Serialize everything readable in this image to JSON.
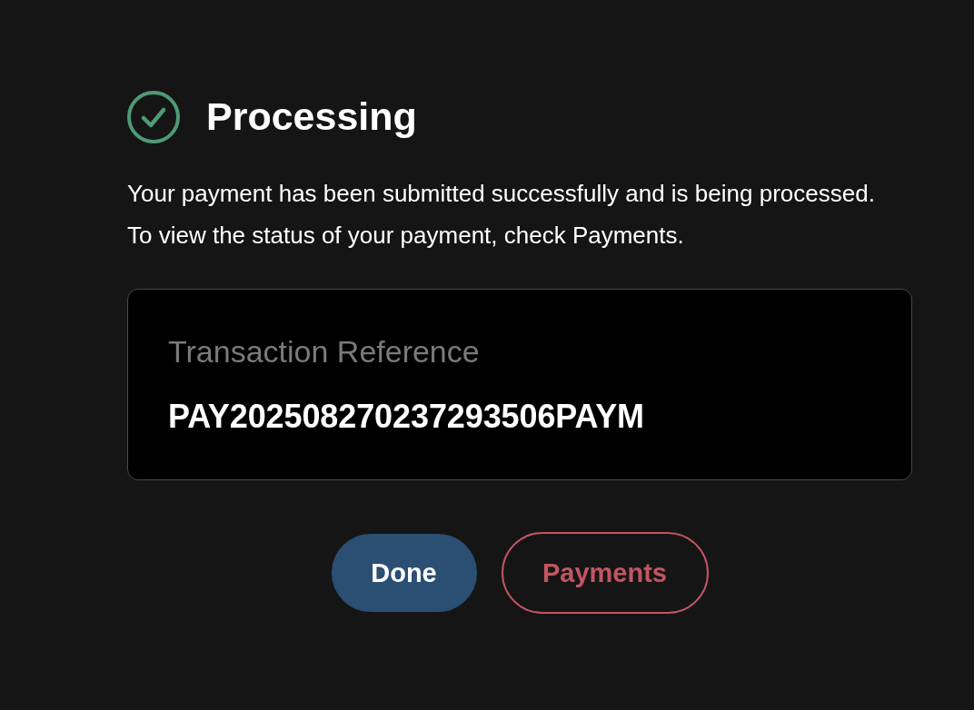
{
  "header": {
    "success": true,
    "title": "Processing"
  },
  "messages": [
    "Your payment has been submitted successfully and is being processed.",
    "To view the status of your payment, check Payments."
  ],
  "reference": {
    "label": "Transaction Reference",
    "value": "PAY202508270237293506PAYM"
  },
  "buttons": [
    {
      "label": "Done",
      "kind": "primary"
    },
    {
      "label": "Payments",
      "kind": "outline"
    }
  ]
}
